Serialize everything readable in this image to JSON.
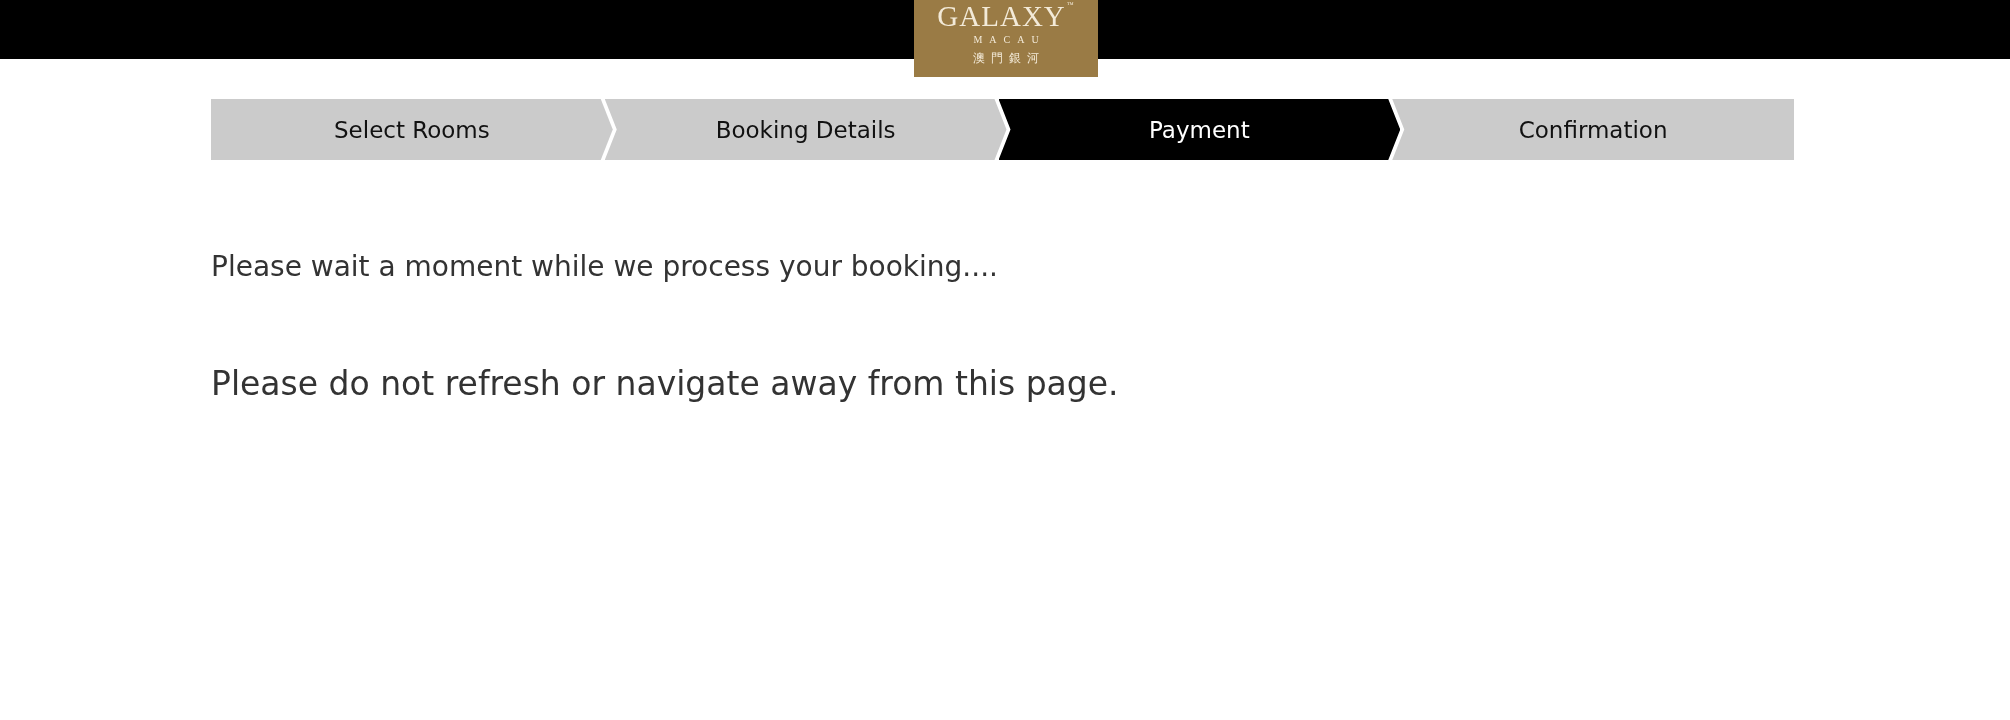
{
  "header": {
    "logo": {
      "name": "GALAXY",
      "trademark": "™",
      "city": "MACAU",
      "chinese": "澳門銀河"
    }
  },
  "steps": [
    {
      "label": "Select Rooms",
      "selected": false
    },
    {
      "label": "Booking Details",
      "selected": false
    },
    {
      "label": "Payment",
      "selected": true
    },
    {
      "label": "Confirmation",
      "selected": false
    }
  ],
  "messages": [
    "Please wait a moment while we process your booking....",
    "Please do not refresh or navigate away from this page."
  ]
}
